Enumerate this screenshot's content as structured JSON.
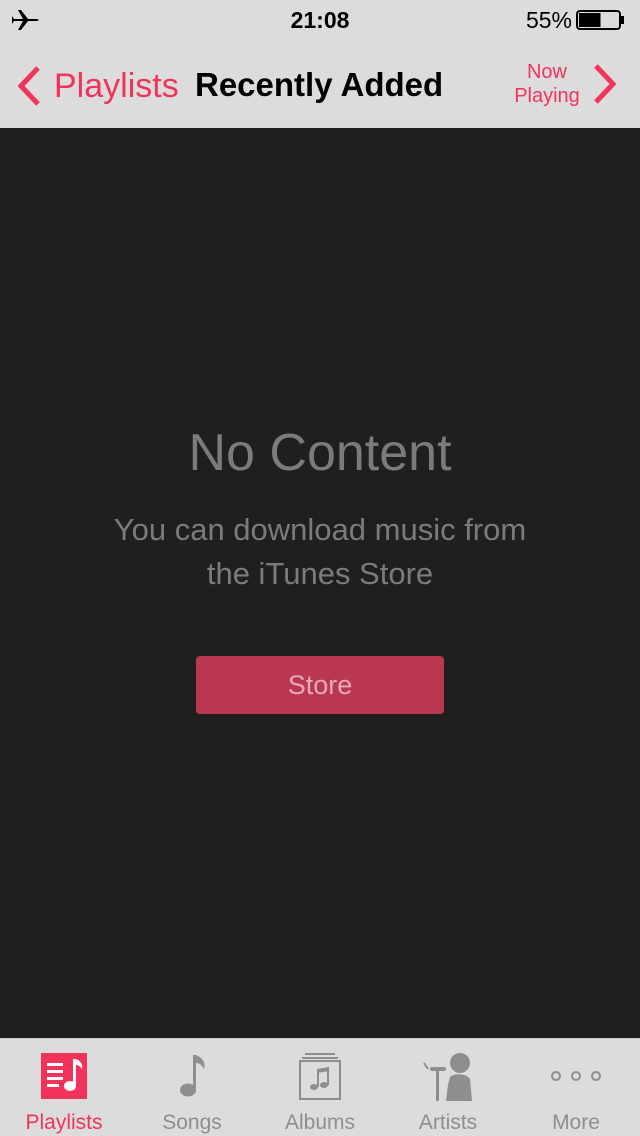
{
  "status_bar": {
    "time": "21:08",
    "battery_percent": "55%",
    "battery_level": 0.55,
    "airplane_icon": "airplane-icon"
  },
  "nav": {
    "back_label": "Playlists",
    "title": "Recently Added",
    "now_playing_line1": "Now",
    "now_playing_line2": "Playing"
  },
  "content": {
    "empty_title": "No Content",
    "empty_line1": "You can download music from",
    "empty_line2": "the iTunes Store",
    "store_button": "Store"
  },
  "tabbar": {
    "tabs": [
      {
        "label": "Playlists",
        "icon": "playlists-icon",
        "active": true
      },
      {
        "label": "Songs",
        "icon": "note-icon",
        "active": false
      },
      {
        "label": "Albums",
        "icon": "albums-icon",
        "active": false
      },
      {
        "label": "Artists",
        "icon": "artist-icon",
        "active": false
      },
      {
        "label": "More",
        "icon": "more-icon",
        "active": false
      }
    ]
  },
  "colors": {
    "accent": "#f2335b",
    "bar_background": "#dcdcdc",
    "content_background": "#1f1f1f",
    "store_button": "#b93750",
    "muted_text": "#7b7b7b",
    "inactive_tab": "#8e8e8e"
  }
}
